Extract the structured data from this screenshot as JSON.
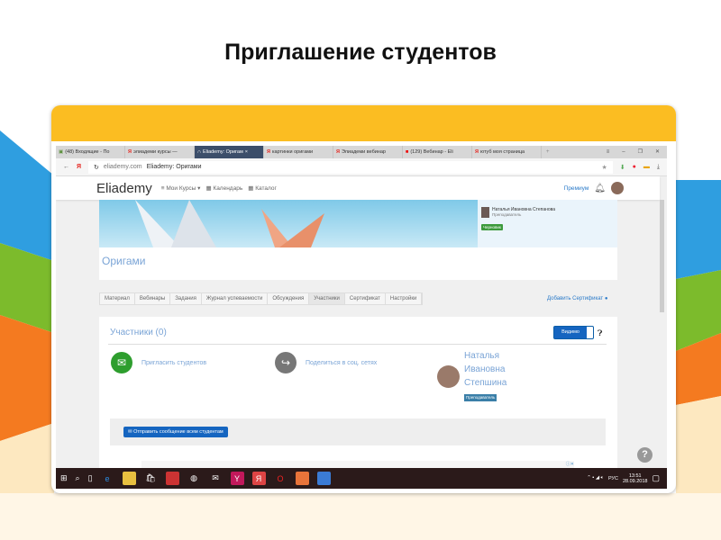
{
  "slide": {
    "title": "Приглашение студентов"
  },
  "browser": {
    "tabs": [
      {
        "label": "(48) Входящие - По"
      },
      {
        "label": "элиадеми курсы —"
      },
      {
        "label": "Eliademy: Оригам"
      },
      {
        "label": "картинки оригами"
      },
      {
        "label": "Элиадеми вебинар"
      },
      {
        "label": "(129) Вебинар - Eli"
      },
      {
        "label": "ютуб моя страница"
      }
    ],
    "new_tab": "+",
    "url_domain": "eliademy.com",
    "url_title": "Eliademy: Оригами"
  },
  "site": {
    "logo": "Eliademy",
    "nav": {
      "my_courses": "Мои Курсы",
      "calendar": "Календарь",
      "catalog": "Каталог"
    },
    "premium": "Премиум"
  },
  "course": {
    "title": "Оригами",
    "teacher_name": "Наталья Ивановна Степанова",
    "teacher_role": "Преподаватель",
    "status": "Черновик",
    "tabs": [
      "Материал",
      "Вебинары",
      "Задания",
      "Журнал успеваемости",
      "Обсуждения",
      "Участники",
      "Сертификат",
      "Настройки"
    ],
    "add_certificate": "Добавить Сертификат"
  },
  "participants": {
    "heading": "Участники (0)",
    "visibility": "Видимо",
    "invite": "Пригласить студентов",
    "share": "Поделиться в соц. сетях",
    "teacher_first": "Наталья",
    "teacher_middle": "Ивановна",
    "teacher_last": "Степшина",
    "teacher_role": "Преподаватель",
    "send_all": "✉ Отправить сообщение всем студентам"
  },
  "taskbar": {
    "lang": "РУС",
    "time": "13:51",
    "date": "28.09.2018"
  }
}
